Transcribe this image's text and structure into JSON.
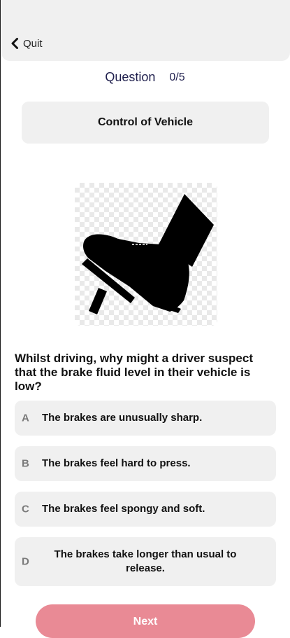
{
  "header": {
    "quit_label": "Quit",
    "quit_icon": "chevron-left-icon"
  },
  "progress": {
    "label": "Question",
    "count": "0/5",
    "current": 0,
    "total": 5
  },
  "category": "Control of Vehicle",
  "illustration": {
    "icon": "foot-on-brake-pedal-icon"
  },
  "question": "Whilst driving, why might a driver suspect that the brake fluid level in their vehicle is low?",
  "options": [
    {
      "letter": "A",
      "text": "The brakes are unusually sharp."
    },
    {
      "letter": "B",
      "text": "The brakes feel hard to press."
    },
    {
      "letter": "C",
      "text": "The brakes feel spongy and soft."
    },
    {
      "letter": "D",
      "text": "The brakes take longer than usual to release."
    }
  ],
  "next_label": "Next",
  "colors": {
    "header_bg": "#f0f0f0",
    "option_bg": "#f0f0f0",
    "next_button": "#e98a95",
    "question_label": "#1f1f4d"
  }
}
